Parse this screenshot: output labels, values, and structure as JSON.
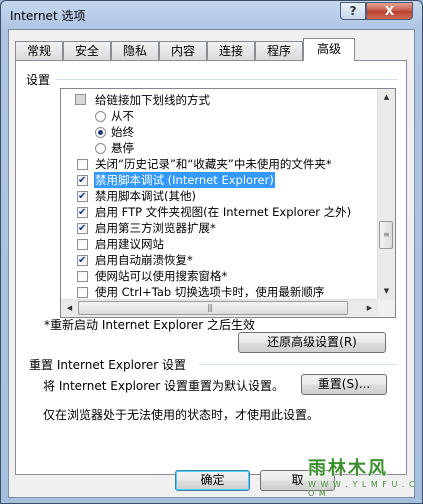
{
  "window": {
    "title": "Internet 选项",
    "help_glyph": "?",
    "close_glyph": "X"
  },
  "tabs": [
    {
      "label": "常规"
    },
    {
      "label": "安全"
    },
    {
      "label": "隐私"
    },
    {
      "label": "内容"
    },
    {
      "label": "连接"
    },
    {
      "label": "程序"
    },
    {
      "label": "高级",
      "active": true
    }
  ],
  "settings": {
    "section_label": "设置",
    "items": [
      {
        "type": "group",
        "label": "给链接加下划线的方式"
      },
      {
        "type": "radio",
        "label": "从不",
        "checked": false
      },
      {
        "type": "radio",
        "label": "始终",
        "checked": true
      },
      {
        "type": "radio",
        "label": "悬停",
        "checked": false
      },
      {
        "type": "checkbox",
        "label": "关闭“历史记录”和“收藏夹”中未使用的文件夹*",
        "checked": false
      },
      {
        "type": "checkbox",
        "label": "禁用脚本调试 (Internet Explorer)",
        "checked": true,
        "selected": true
      },
      {
        "type": "checkbox",
        "label": "禁用脚本调试(其他)",
        "checked": true
      },
      {
        "type": "checkbox",
        "label": "启用 FTP 文件夹视图(在 Internet Explorer 之外)",
        "checked": true
      },
      {
        "type": "checkbox",
        "label": "启用第三方浏览器扩展*",
        "checked": true
      },
      {
        "type": "checkbox",
        "label": "启用建议网站",
        "checked": false
      },
      {
        "type": "checkbox",
        "label": "启用自动崩溃恢复*",
        "checked": true
      },
      {
        "type": "checkbox",
        "label": "使网站可以使用搜索窗格*",
        "checked": false
      },
      {
        "type": "checkbox",
        "label": "使用 Ctrl+Tab 切换选项卡时，使用最新顺序",
        "checked": false
      }
    ],
    "restart_note": "*重新启动 Internet Explorer 之后生效",
    "restore_button": "还原高级设置(R)"
  },
  "reset": {
    "section_label": "重置 Internet Explorer 设置",
    "description": "将 Internet Explorer 设置重置为默认设置。",
    "reset_button": "重置(S)...",
    "note": "仅在浏览器处于无法使用的状态时，才使用此设置。"
  },
  "footer": {
    "ok_button": "确定",
    "cancel_button": "取"
  },
  "watermark": {
    "logo_text": "雨林木风",
    "url_text": "W W W . Y L M F U . C O M"
  },
  "colors": {
    "selection": "#3399ff",
    "frame": "#a6bfdf"
  }
}
